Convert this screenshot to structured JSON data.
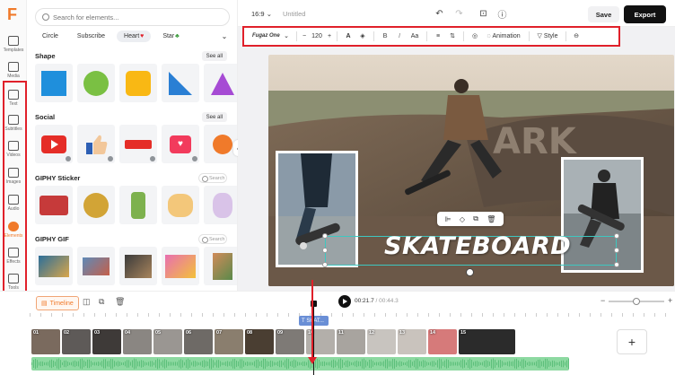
{
  "rail": {
    "items": [
      {
        "label": "Templates"
      },
      {
        "label": "Media"
      },
      {
        "label": "Text"
      },
      {
        "label": "Subtitles"
      },
      {
        "label": "Videos"
      },
      {
        "label": "Images"
      },
      {
        "label": "Audio"
      },
      {
        "label": "Elements"
      },
      {
        "label": "Effects"
      },
      {
        "label": "Tools"
      }
    ]
  },
  "panel": {
    "search_placeholder": "Search for elements...",
    "chips": [
      "Circle",
      "Subscribe",
      "Heart",
      "Star"
    ],
    "sections": [
      {
        "title": "Shape",
        "action": "See all"
      },
      {
        "title": "Social",
        "action": "See all"
      },
      {
        "title": "GIPHY Sticker",
        "action": "Search"
      },
      {
        "title": "GIPHY GIF",
        "action": "Search"
      }
    ]
  },
  "topbar": {
    "ratio": "16:9",
    "title": "Untitled",
    "save_label": "Save",
    "export_label": "Export"
  },
  "textbar": {
    "font": "Fugaz One",
    "size": "120",
    "case": "Aa",
    "animation_label": "Animation",
    "style_label": "Style"
  },
  "canvas": {
    "headline": "SKATEBOARD"
  },
  "timeline": {
    "button_label": "Timeline",
    "current_time": "00:21.7",
    "separator": " / ",
    "total_time": "00:44.3",
    "text_clip_label": "SKAT...",
    "clip_numbers": [
      "01",
      "02",
      "03",
      "04",
      "05",
      "06",
      "07",
      "08",
      "09",
      "10",
      "11",
      "12",
      "13",
      "14",
      "15"
    ],
    "add_label": "+"
  },
  "colors": {
    "accent": "#f07a2a",
    "annotation": "#e0202a",
    "selection": "#3ec7c0",
    "audio": "#8dd9a1",
    "text_clip": "#6a8fd6"
  }
}
